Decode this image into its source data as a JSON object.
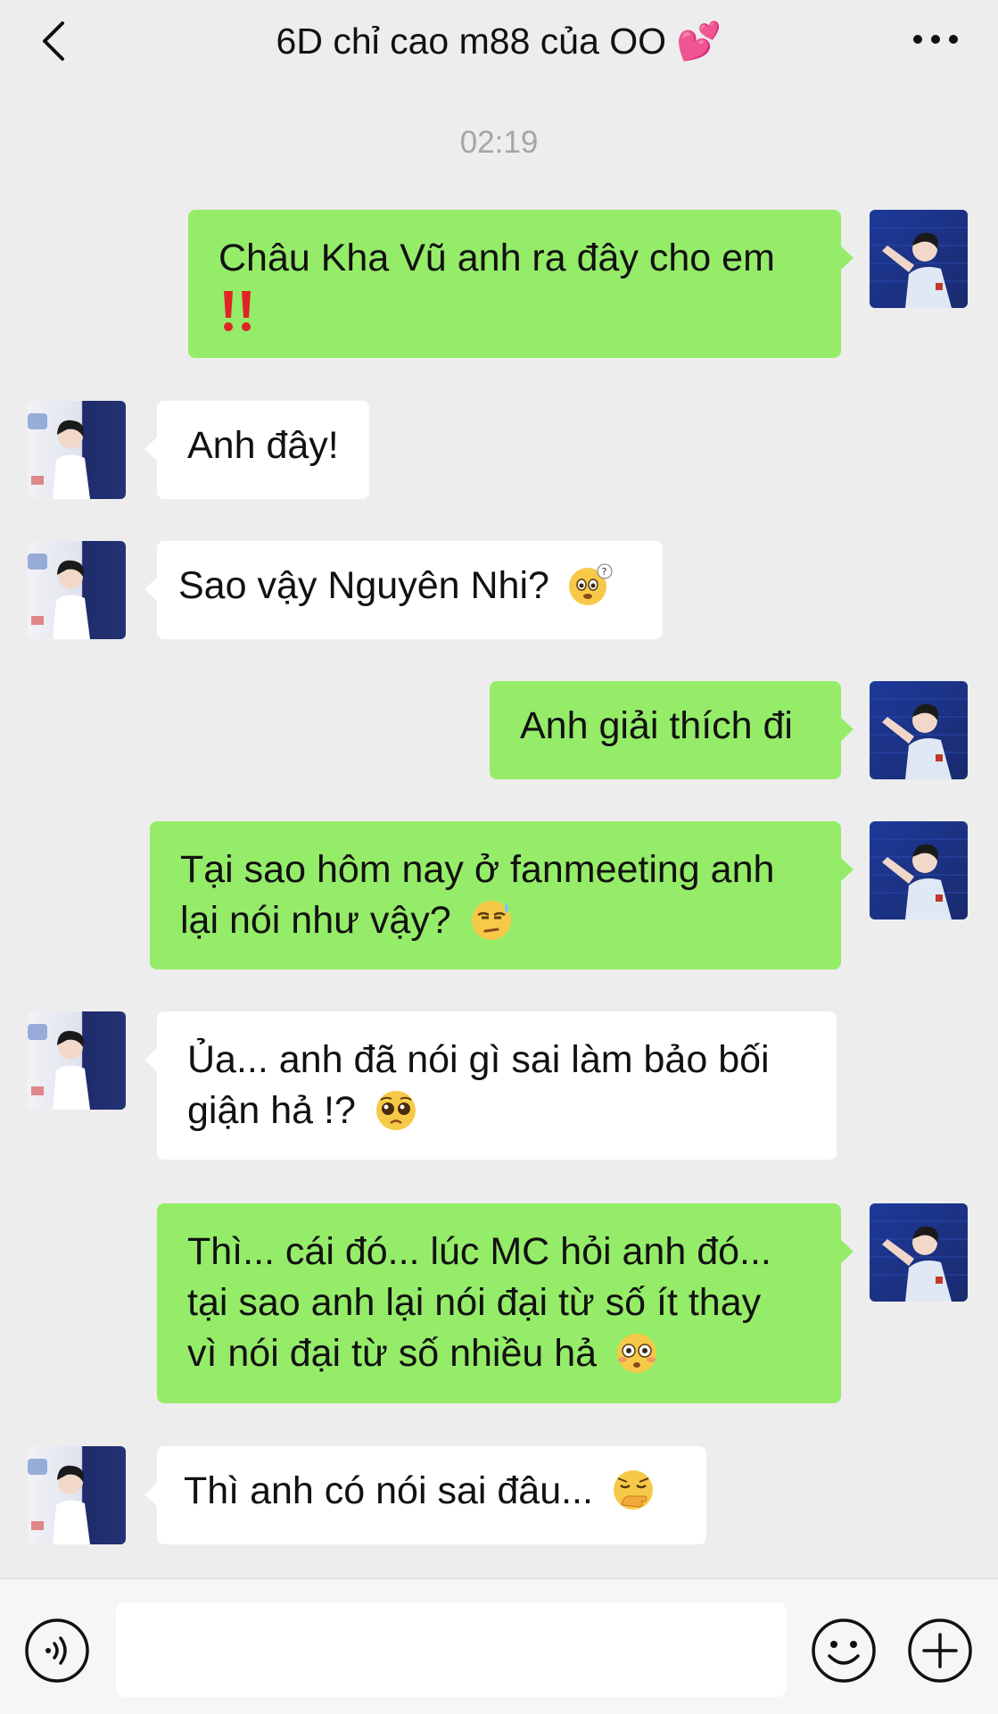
{
  "header": {
    "title": "6D chỉ cao m88 của OO 💕",
    "back_icon": "chevron-left-icon",
    "more_icon": "more-dots-icon"
  },
  "timestamp": "02:19",
  "messages": [
    {
      "sender": "me",
      "text": "Châu Kha Vũ anh ra đây cho em",
      "emoji": "double-exclamation-emoji"
    },
    {
      "sender": "other",
      "text": "Anh đây!"
    },
    {
      "sender": "other",
      "text": "Sao vậy Nguyên Nhi?",
      "emoji": "confused-emoji"
    },
    {
      "sender": "me",
      "text": "Anh giải thích đi"
    },
    {
      "sender": "me",
      "text_line1": "Tại sao hôm nay ở fanmeeting anh",
      "text_line2": "lại nói như vậy?",
      "emoji": "sweat-eyeroll-emoji"
    },
    {
      "sender": "other",
      "text_line1": "Ủa... anh đã nói gì sai làm bảo bối",
      "text_line2": "giận hả !?",
      "emoji": "pleading-emoji"
    },
    {
      "sender": "me",
      "text_line1": "Thì... cái đó... lúc MC hỏi anh đó...",
      "text_line2": "tại sao anh lại nói đại từ số ít thay",
      "text_line3": "vì nói đại từ số nhiều hả",
      "emoji": "flushed-emoji"
    },
    {
      "sender": "other",
      "text": "Thì anh có nói sai đâu...",
      "emoji": "hand-over-mouth-emoji"
    }
  ],
  "input": {
    "value": "",
    "voice_icon": "voice-icon",
    "emoji_icon": "emoji-smile-icon",
    "plus_icon": "plus-icon"
  },
  "colors": {
    "background": "#ededed",
    "my_bubble": "#95ec69",
    "other_bubble": "#ffffff",
    "timestamp": "#a6a6a6"
  }
}
